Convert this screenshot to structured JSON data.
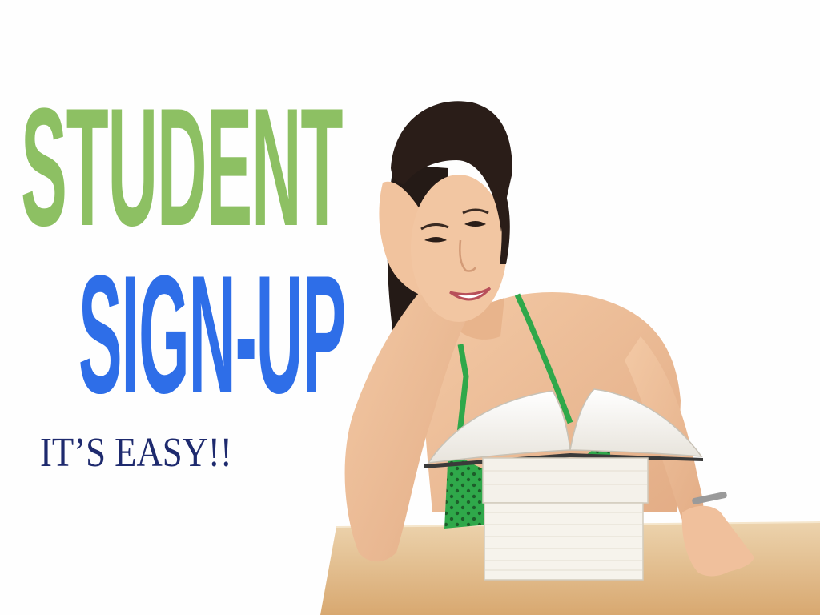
{
  "banner": {
    "line1": "STUDENT",
    "line2": "SIGN-UP",
    "tagline": "IT’S EASY!!"
  },
  "colors": {
    "line1": "#8dc063",
    "line2": "#2e6ee8",
    "tagline": "#1e2a6e",
    "background": "#fefefe",
    "table": "#e3bd89",
    "top_green": "#2fa84a"
  }
}
